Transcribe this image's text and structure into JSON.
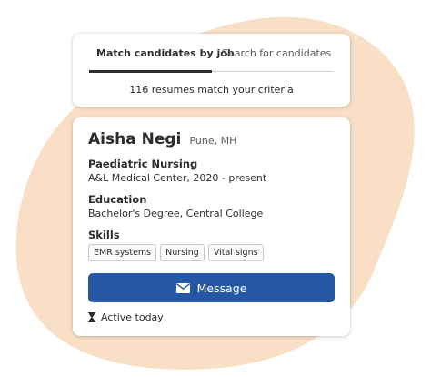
{
  "colors": {
    "background_blob": "#f8dfc5",
    "primary_button": "#2557a7",
    "text_primary": "#2d2d2d"
  },
  "search_card": {
    "tabs": [
      {
        "label": "Match candidates by job",
        "active": true
      },
      {
        "label": "Search for candidates",
        "active": false
      }
    ],
    "match_text": "116 resumes match your criteria"
  },
  "profile": {
    "name": "Aisha Negi",
    "location": "Pune, MH",
    "job_title": "Paediatric Nursing",
    "job_detail": "A&L Medical Center, 2020 - present",
    "education_label": "Education",
    "education_detail": "Bachelor's Degree, Central College",
    "skills_label": "Skills",
    "skills": [
      "EMR systems",
      "Nursing",
      "Vital signs"
    ],
    "message_button": "Message",
    "message_icon": "envelope-icon",
    "activity_icon": "hourglass-icon",
    "activity": "Active today"
  }
}
